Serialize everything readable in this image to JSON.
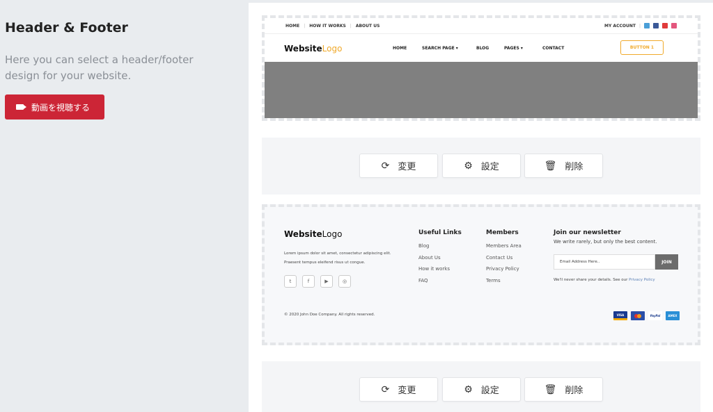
{
  "left": {
    "title": "Header & Footer",
    "description": "Here you can select a header/footer design for your website.",
    "video_button": "動画を視聴する"
  },
  "header_preview": {
    "top_links": [
      "HOME",
      "HOW IT WORKS",
      "ABOUT US"
    ],
    "account": "MY ACCOUNT",
    "logo_bold": "Website",
    "logo_light": "Logo",
    "menu": [
      "HOME",
      "SEARCH PAGE ▾",
      "BLOG",
      "PAGES ▾",
      "CONTACT"
    ],
    "cta_button": "BUTTON 1"
  },
  "actions": {
    "change": "変更",
    "settings": "設定",
    "delete": "削除"
  },
  "footer_preview": {
    "logo_bold": "Website",
    "logo_light": "Logo",
    "description": "Lorem ipsum dolor sit amet, consectetur adipiscing elit. Praesent tempus eleifend risus ut congue.",
    "useful_links_title": "Useful Links",
    "useful_links": [
      "Blog",
      "About Us",
      "How it works",
      "FAQ"
    ],
    "members_title": "Members",
    "members_links": [
      "Members Area",
      "Contact Us",
      "Privacy Policy",
      "Terms"
    ],
    "newsletter_title": "Join our newsletter",
    "newsletter_sub": "We write rarely, but only the best content.",
    "email_placeholder": "Email Address Here..",
    "join_button": "JOIN",
    "note_text": "We'll never share your details. See our ",
    "note_link": "Privacy Policy",
    "copyright": "© 2020 John Doe Company. All rights reserved.",
    "payment_cards": [
      "VISA",
      "MC",
      "PayPal",
      "AMEX"
    ]
  },
  "colors": {
    "accent_red": "#cc2536",
    "logo_orange": "#f0a92a",
    "hero_gray": "#808080"
  }
}
